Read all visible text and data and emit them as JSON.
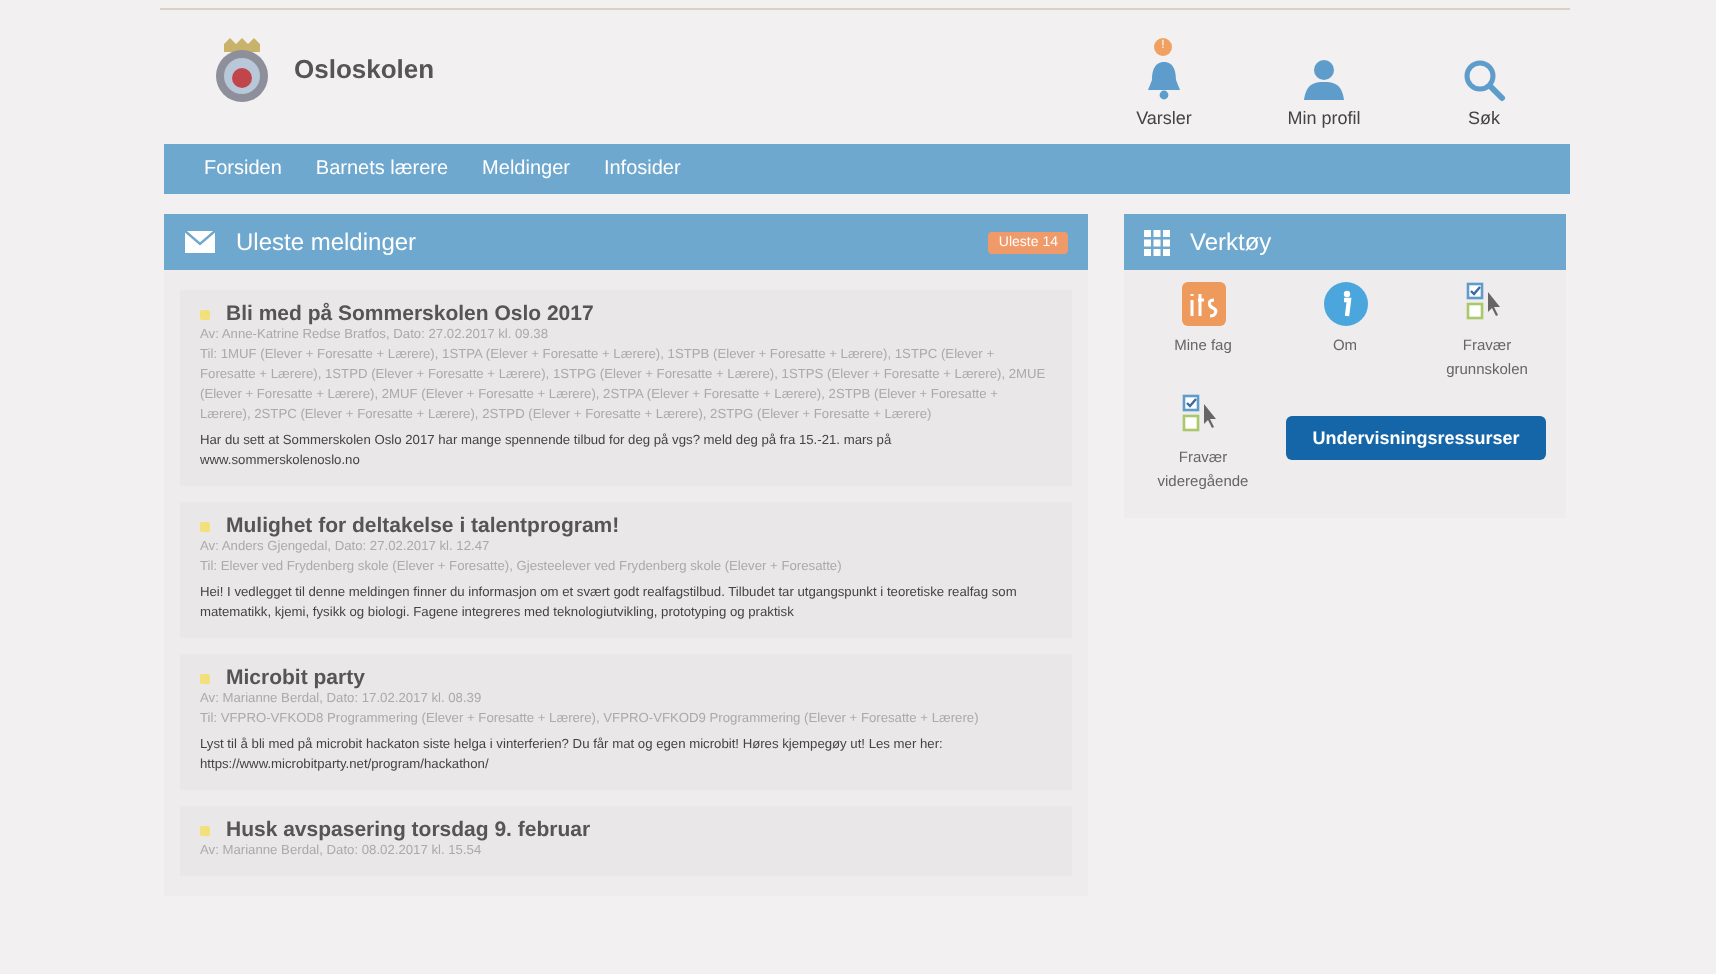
{
  "header": {
    "site_name": "Osloskolen",
    "actions": [
      {
        "kind": "bell",
        "label": "Varsler",
        "badge": "!"
      },
      {
        "kind": "profile",
        "label": "Min profil"
      },
      {
        "kind": "search",
        "label": "Søk"
      }
    ]
  },
  "nav": [
    "Forsiden",
    "Barnets lærere",
    "Meldinger",
    "Infosider"
  ],
  "messages_panel": {
    "title": "Uleste meldinger",
    "badge": "Uleste 14",
    "messages": [
      {
        "unread": true,
        "title": "Bli med på Sommerskolen Oslo 2017",
        "author": "Av: Anne-Katrine Redse Bratfos, Dato: 27.02.2017 kl. 09.38",
        "recipients": "Til: 1MUF (Elever + Foresatte + Lærere), 1STPA (Elever + Foresatte + Lærere), 1STPB (Elever + Foresatte + Lærere), 1STPC (Elever + Foresatte + Lærere), 1STPD (Elever + Foresatte + Lærere), 1STPG (Elever + Foresatte + Lærere), 1STPS (Elever + Foresatte + Lærere), 2MUE (Elever + Foresatte + Lærere), 2MUF (Elever + Foresatte + Lærere), 2STPA (Elever + Foresatte + Lærere), 2STPB (Elever + Foresatte + Lærere), 2STPC (Elever + Foresatte + Lærere), 2STPD (Elever + Foresatte + Lærere), 2STPG (Elever + Foresatte + Lærere)",
        "body": "Har du sett at Sommerskolen Oslo 2017 har mange spennende tilbud for deg på vgs? meld deg på fra 15.-21. mars på www.sommerskolenoslo.no"
      },
      {
        "unread": true,
        "title": "Mulighet for deltakelse i talentprogram!",
        "author": "Av: Anders Gjengedal, Dato: 27.02.2017 kl. 12.47",
        "recipients": "Til: Elever ved Frydenberg skole (Elever + Foresatte), Gjesteelever ved Frydenberg skole (Elever + Foresatte)",
        "body": "Hei! I vedlegget til denne meldingen finner du informasjon om et svært godt realfagstilbud. Tilbudet tar utgangspunkt i teoretiske realfag som matematikk, kjemi, fysikk og biologi. Fagene integreres med teknologiutvikling, prototyping og praktisk"
      },
      {
        "unread": true,
        "title": "Microbit party",
        "author": "Av: Marianne Berdal, Dato: 17.02.2017 kl. 08.39",
        "recipients": "Til: VFPRO-VFKOD8 Programmering (Elever + Foresatte + Lærere), VFPRO-VFKOD9 Programmering (Elever + Foresatte + Lærere)",
        "body": "Lyst til å bli med på microbit hackaton siste helga i vinterferien? Du får mat og egen microbit! Høres kjempegøy ut! Les mer her: https://www.microbitparty.net/program/hackathon/"
      },
      {
        "unread": true,
        "title": "Husk avspasering torsdag 9. februar",
        "author": "Av: Marianne Berdal, Dato: 08.02.2017 kl. 15.54"
      }
    ]
  },
  "tools_panel": {
    "title": "Verktøy",
    "tools": [
      {
        "kind": "its",
        "label": "Mine fag"
      },
      {
        "kind": "info",
        "label": "Om"
      },
      {
        "kind": "checklist",
        "label": "Fravær grunnskolen"
      },
      {
        "kind": "checklist",
        "label": "Fravær videregående"
      },
      {
        "kind": "button",
        "label": "Undervisningsressurser"
      }
    ]
  }
}
